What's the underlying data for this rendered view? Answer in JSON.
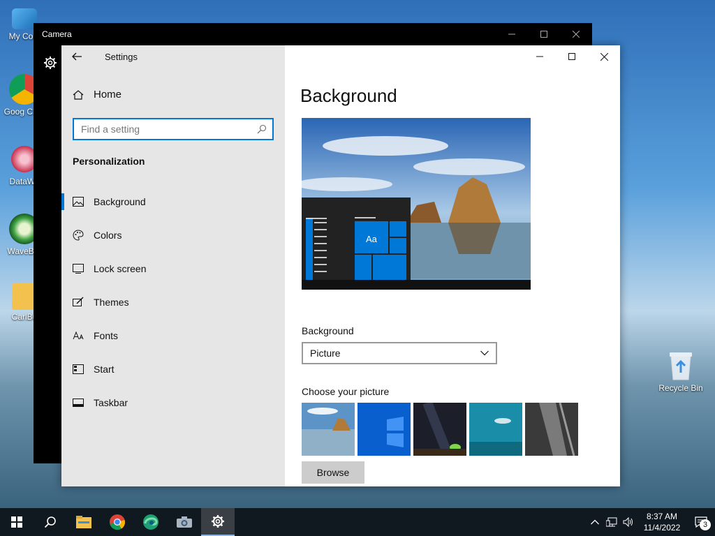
{
  "desktop": {
    "icons": [
      {
        "label": "My Com",
        "icon": "computer-icon"
      },
      {
        "label": "Goog Chro",
        "icon": "chrome-icon"
      },
      {
        "label": "DataWa",
        "icon": "datawave-icon"
      },
      {
        "label": "WaveBro",
        "icon": "wavebrowser-icon"
      },
      {
        "label": "CarlBu",
        "icon": "folder-icon"
      }
    ],
    "recycle_bin": {
      "label": "Recycle Bin",
      "icon": "recycle-bin-icon"
    }
  },
  "camera_window": {
    "title": "Camera"
  },
  "settings": {
    "title": "Settings",
    "home_label": "Home",
    "search": {
      "placeholder": "Find a setting",
      "value": ""
    },
    "section_title": "Personalization",
    "nav_items": [
      {
        "label": "Background",
        "icon": "picture-icon",
        "active": true
      },
      {
        "label": "Colors",
        "icon": "palette-icon",
        "active": false
      },
      {
        "label": "Lock screen",
        "icon": "lock-screen-icon",
        "active": false
      },
      {
        "label": "Themes",
        "icon": "themes-icon",
        "active": false
      },
      {
        "label": "Fonts",
        "icon": "fonts-icon",
        "active": false
      },
      {
        "label": "Start",
        "icon": "start-icon",
        "active": false
      },
      {
        "label": "Taskbar",
        "icon": "taskbar-icon",
        "active": false
      }
    ],
    "page_title": "Background",
    "preview_tile_text": "Aa",
    "background_label": "Background",
    "background_value": "Picture",
    "choose_label": "Choose your picture",
    "browse_label": "Browse",
    "accent_color": "#0078d7"
  },
  "taskbar": {
    "apps": [
      "start-icon",
      "search-icon",
      "file-explorer-icon",
      "chrome-icon",
      "edge-icon",
      "camera-icon",
      "settings-icon"
    ],
    "time": "8:37 AM",
    "date": "11/4/2022",
    "notification_count": "3"
  }
}
